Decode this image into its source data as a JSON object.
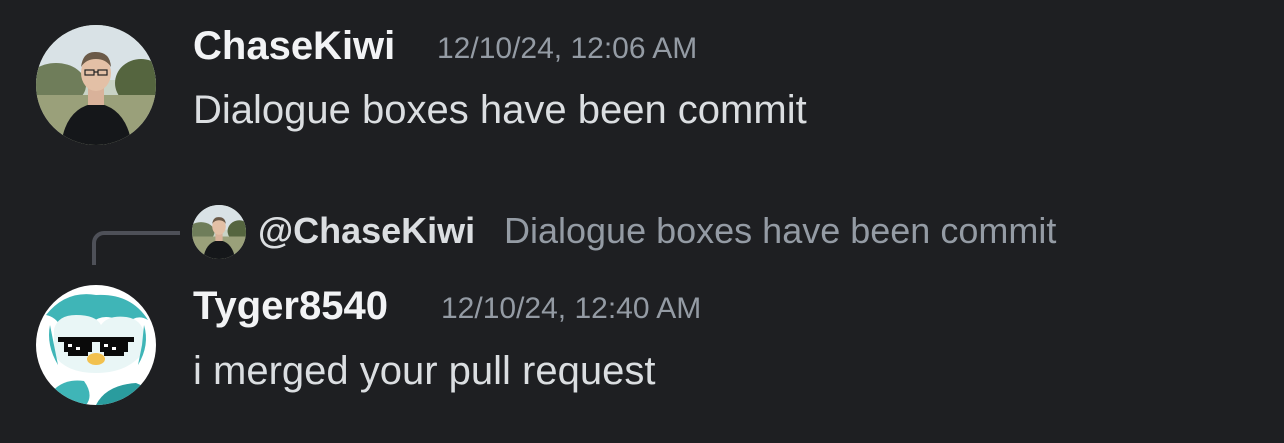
{
  "messages": [
    {
      "username": "ChaseKiwi",
      "timestamp": "12/10/24, 12:06 AM",
      "content": "Dialogue boxes have been commit"
    },
    {
      "reply": {
        "mention": "@ChaseKiwi",
        "preview": "Dialogue boxes have been commit"
      },
      "username": "Tyger8540",
      "timestamp": "12/10/24, 12:40 AM",
      "content": "i merged your pull request"
    }
  ]
}
